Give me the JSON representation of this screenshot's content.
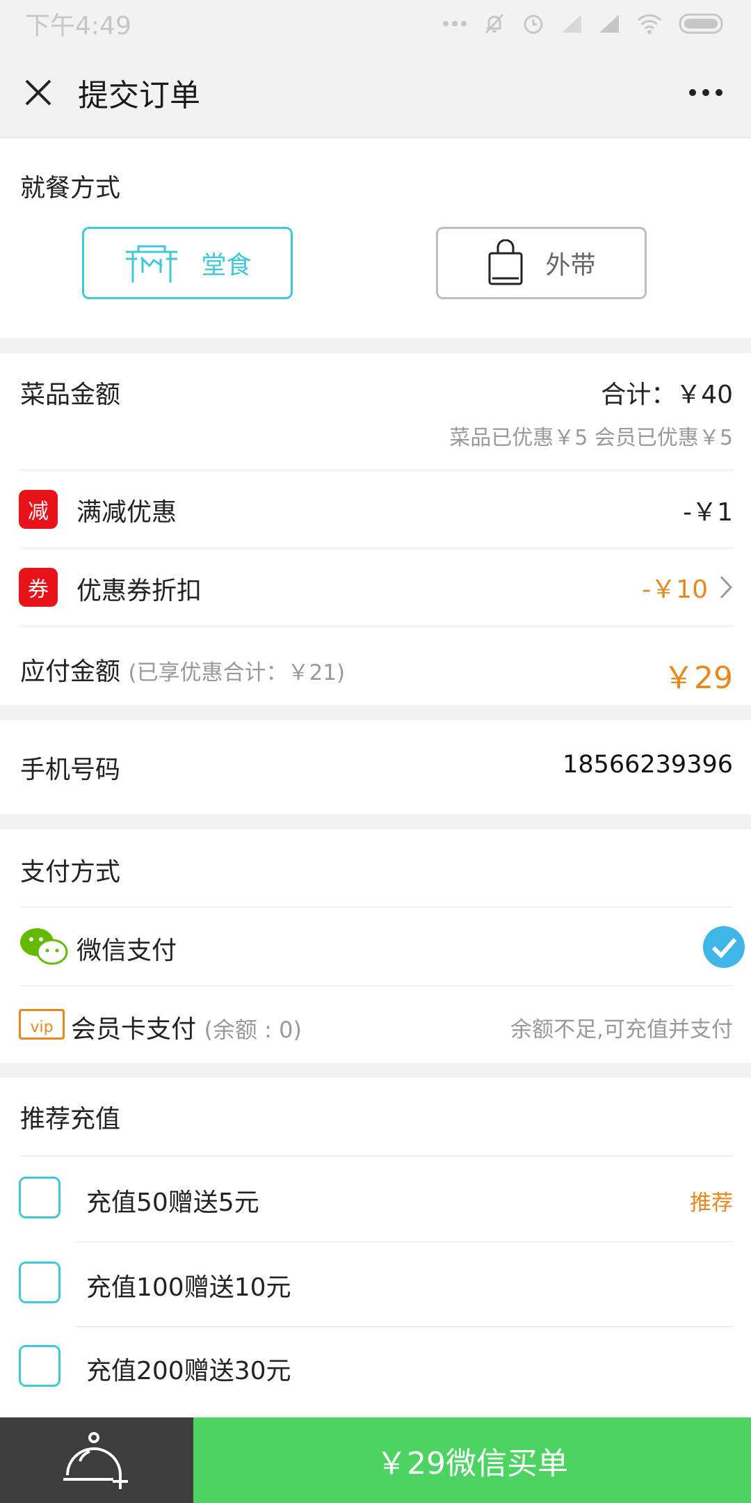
{
  "status_bar": {
    "time": "下午4:49"
  },
  "nav": {
    "title": "提交订单"
  },
  "dining": {
    "title": "就餐方式",
    "options": [
      {
        "label": "堂食",
        "selected": true
      },
      {
        "label": "外带",
        "selected": false
      }
    ]
  },
  "amount": {
    "label": "菜品金额",
    "total": "合计：￥40",
    "discount_note": "菜品已优惠￥5  会员已优惠￥5",
    "full_reduction": {
      "badge": "减",
      "label": "满减优惠",
      "value": "-￥1"
    },
    "coupon": {
      "badge": "券",
      "label": "优惠券折扣",
      "value": "-￥10"
    },
    "payable": {
      "label": "应付金额",
      "note": "(已享优惠合计：￥21)",
      "value": "￥29"
    }
  },
  "phone": {
    "label": "手机号码",
    "value": "18566239396"
  },
  "payment": {
    "title": "支付方式",
    "wechat": {
      "label": "微信支付",
      "selected": true
    },
    "member_card": {
      "icon_text": "vip",
      "label": "会员卡支付",
      "note": "(余额 : 0)",
      "hint": "余额不足,可充值并支付"
    }
  },
  "recharge": {
    "title": "推荐充值",
    "options": [
      {
        "label": "充值50赠送5元",
        "badge": "推荐"
      },
      {
        "label": "充值100赠送10元",
        "badge": ""
      },
      {
        "label": "充值200赠送30元",
        "badge": ""
      }
    ]
  },
  "bottom_bar": {
    "pay_button": "￥29微信买单"
  },
  "colors": {
    "accent": "#3fc9d8",
    "orange": "#e8871e",
    "red_badge": "#e8121a",
    "wechat_green": "#4dd362"
  }
}
